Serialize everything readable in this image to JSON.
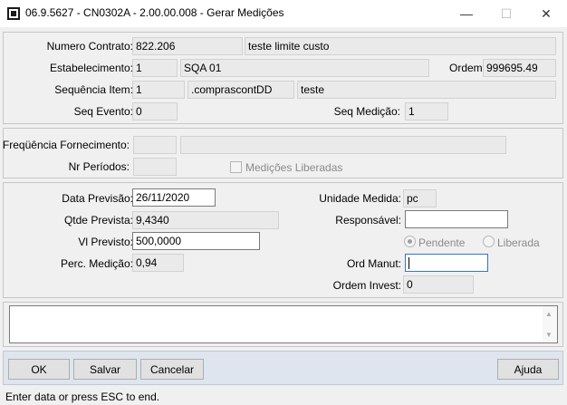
{
  "window": {
    "title": "06.9.5627 - CN0302A - 2.00.00.008 - Gerar Medições",
    "minimize_glyph": "—",
    "maximize_glyph": "☐",
    "close_glyph": "✕"
  },
  "contract": {
    "numero_label": "Numero Contrato:",
    "numero_value": "822.206",
    "numero_desc": "teste limite custo",
    "estab_label": "Estabelecimento:",
    "estab_value": "1",
    "estab_desc": "SQA 01",
    "ordem_label": "Ordem:",
    "ordem_value": "999695.49",
    "seq_item_label": "Sequência Item:",
    "seq_item_value": "1",
    "seq_item_code": ".comprascontDD",
    "seq_item_desc": "teste",
    "seq_evento_label": "Seq Evento:",
    "seq_evento_value": "0",
    "seq_medicao_label": "Seq Medição:",
    "seq_medicao_value": "1"
  },
  "supply": {
    "freq_label": "Freqüência Fornecimento:",
    "freq_value": "",
    "freq_desc": "",
    "nr_periodos_label": "Nr Períodos:",
    "nr_periodos_value": "",
    "medicoes_liberadas_label": "Medições Liberadas",
    "medicoes_liberadas_checked": false
  },
  "measurement": {
    "data_previsao_label": "Data Previsão:",
    "data_previsao_value": "26/11/2020",
    "qtde_prevista_label": "Qtde Prevista:",
    "qtde_prevista_value": "9,4340",
    "vl_previsto_label": "Vl Previsto:",
    "vl_previsto_value": "500,0000",
    "perc_medicao_label": "Perc. Medição:",
    "perc_medicao_value": "0,94",
    "unidade_label": "Unidade Medida:",
    "unidade_value": "pc",
    "responsavel_label": "Responsável:",
    "responsavel_value": "",
    "status_pendente_label": "Pendente",
    "status_liberada_label": "Liberada",
    "status_selected": "Pendente",
    "ord_manut_label": "Ord Manut:",
    "ord_manut_value": "",
    "ord_invest_label": "Ordem Invest:",
    "ord_invest_value": "0"
  },
  "memo": {
    "value": ""
  },
  "buttons": {
    "ok": "OK",
    "salvar": "Salvar",
    "cancelar": "Cancelar",
    "ajuda": "Ajuda"
  },
  "status_bar": {
    "text": "Enter data or press ESC to end."
  }
}
